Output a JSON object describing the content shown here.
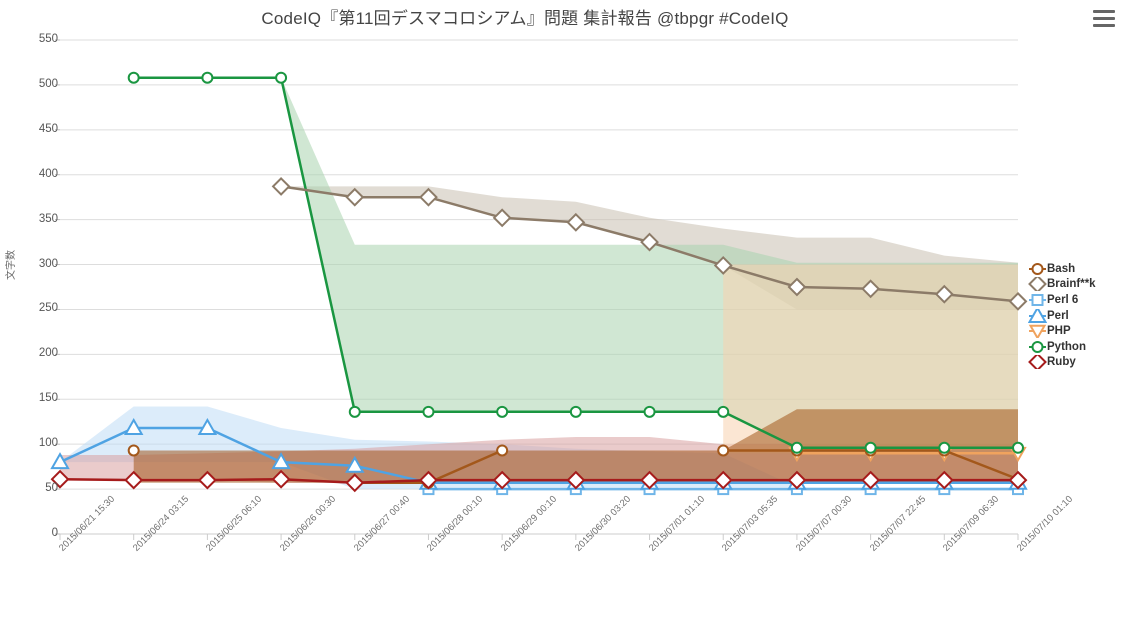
{
  "header": {
    "title": "CodeIQ『第11回デスマコロシアム』問題 集計報告 @tbpgr #CodeIQ",
    "menu_icon": "hamburger-icon"
  },
  "chart_data": {
    "type": "line",
    "title": "CodeIQ『第11回デスマコロシアム』問題 集計報告 @tbpgr #CodeIQ",
    "xlabel": "",
    "ylabel": "文字数",
    "ylim": [
      0,
      550
    ],
    "ytick_step": 50,
    "yticks": [
      0,
      50,
      100,
      150,
      200,
      250,
      300,
      350,
      400,
      450,
      500,
      550
    ],
    "grid": true,
    "legend_position": "right",
    "categories": [
      "2015/06/21 15:30",
      "2015/06/24 03:15",
      "2015/06/25 06:10",
      "2015/06/26 00:30",
      "2015/06/27 00:40",
      "2015/06/28 00:10",
      "2015/06/29 00:10",
      "2015/06/30 03:20",
      "2015/07/01 01:10",
      "2015/07/03 05:35",
      "2015/07/07 00:30",
      "2015/07/07 22:45",
      "2015/07/09 06:30",
      "2015/07/10 01:10"
    ],
    "series": [
      {
        "name": "Bash",
        "color": "#A3581B",
        "band_color": "#A3581B",
        "marker": "circle",
        "values": [
          null,
          93,
          null,
          null,
          57,
          57,
          93,
          null,
          null,
          93,
          93,
          93,
          93,
          61
        ],
        "band_upper": [
          null,
          93,
          93,
          93,
          93,
          93,
          93,
          93,
          93,
          93,
          139,
          139,
          139,
          139
        ],
        "band_lower": [
          null,
          57,
          57,
          57,
          57,
          57,
          57,
          57,
          57,
          57,
          57,
          57,
          57,
          57
        ]
      },
      {
        "name": "Brainf**k",
        "color": "#8C7B68",
        "band_color": "#C9BFB0",
        "marker": "diamond",
        "values": [
          null,
          null,
          null,
          387,
          375,
          375,
          352,
          347,
          325,
          299,
          275,
          273,
          267,
          259
        ],
        "band_upper": [
          null,
          null,
          null,
          387,
          387,
          387,
          375,
          370,
          352,
          340,
          330,
          330,
          310,
          302
        ],
        "band_lower": [
          null,
          null,
          null,
          387,
          375,
          375,
          352,
          347,
          325,
          299,
          250,
          250,
          250,
          250
        ]
      },
      {
        "name": "Perl 6",
        "color": "#6FB5E8",
        "band_color": "#BFDCF5",
        "marker": "square",
        "values": [
          null,
          null,
          null,
          null,
          null,
          50,
          50,
          50,
          50,
          50,
          50,
          50,
          50,
          50
        ],
        "band_upper": [
          80,
          142,
          142,
          118,
          105,
          103,
          100,
          95,
          92,
          90,
          52,
          52,
          52,
          52
        ],
        "band_lower": [
          80,
          80,
          80,
          80,
          50,
          50,
          50,
          50,
          50,
          50,
          50,
          50,
          50,
          50
        ]
      },
      {
        "name": "Perl",
        "color": "#4FA3E3",
        "band_color": "#BFDCF5",
        "marker": "triangle",
        "values": [
          80,
          118,
          118,
          80,
          76,
          57,
          57,
          57,
          57,
          57,
          57,
          57,
          57,
          57
        ],
        "band_upper": [
          80,
          142,
          142,
          118,
          105,
          103,
          100,
          95,
          92,
          90,
          57,
          57,
          57,
          57
        ],
        "band_lower": [
          80,
          80,
          80,
          80,
          57,
          57,
          57,
          57,
          57,
          57,
          57,
          57,
          57,
          57
        ]
      },
      {
        "name": "PHP",
        "color": "#F0A35E",
        "band_color": "#F7D2AF",
        "marker": "triangle-down",
        "values": [
          null,
          null,
          null,
          null,
          null,
          null,
          null,
          null,
          null,
          null,
          90,
          90,
          90,
          90
        ],
        "band_upper": [
          null,
          null,
          null,
          null,
          null,
          null,
          null,
          null,
          null,
          300,
          300,
          300,
          300,
          300
        ],
        "band_lower": [
          null,
          null,
          null,
          null,
          null,
          null,
          null,
          null,
          null,
          90,
          90,
          90,
          90,
          90
        ]
      },
      {
        "name": "Python",
        "color": "#1A9641",
        "band_color": "#A9D3AE",
        "marker": "circle",
        "values": [
          null,
          508,
          508,
          508,
          136,
          136,
          136,
          136,
          136,
          136,
          96,
          96,
          96,
          96
        ],
        "band_upper": [
          null,
          508,
          508,
          508,
          322,
          322,
          322,
          322,
          322,
          322,
          302,
          302,
          302,
          302
        ],
        "band_lower": [
          null,
          508,
          508,
          508,
          136,
          136,
          136,
          136,
          136,
          136,
          96,
          96,
          96,
          96
        ]
      },
      {
        "name": "Ruby",
        "color": "#A61B1B",
        "band_color": "#D9A0A0",
        "marker": "diamond",
        "values": [
          61,
          60,
          60,
          61,
          57,
          60,
          60,
          60,
          60,
          60,
          60,
          60,
          60,
          60
        ],
        "band_upper": [
          88,
          88,
          90,
          92,
          95,
          100,
          105,
          108,
          108,
          100,
          100,
          100,
          100,
          100
        ],
        "band_lower": [
          61,
          60,
          60,
          57,
          57,
          57,
          57,
          57,
          57,
          57,
          57,
          57,
          57,
          57
        ]
      }
    ]
  },
  "legend": {
    "items": [
      {
        "label": "Bash"
      },
      {
        "label": "Brainf**k"
      },
      {
        "label": "Perl 6"
      },
      {
        "label": "Perl"
      },
      {
        "label": "PHP"
      },
      {
        "label": "Python"
      },
      {
        "label": "Ruby"
      }
    ]
  }
}
